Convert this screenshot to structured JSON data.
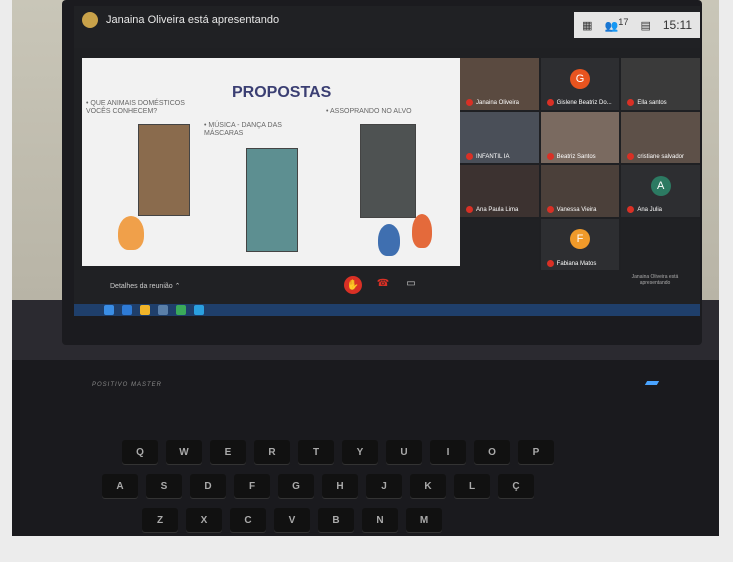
{
  "meeting": {
    "presenter_text": "Janaina Oliveira está apresentando",
    "clock": "15:11",
    "participant_count": "17",
    "details_label": "Detalhes da reunião",
    "present_label": "Janaina Oliveira está apresentando"
  },
  "slide": {
    "title": "PROPOSTAS",
    "item1": "• QUE ANIMAIS DOMÉSTICOS VOCÊS CONHECEM?",
    "item2": "• MÚSICA - DANÇA DAS MÁSCARAS",
    "item3": "• ASSOPRANDO NO ALVO"
  },
  "participants": [
    {
      "name": "Janaina Oliveira",
      "initial": "",
      "color": "#5a4a40"
    },
    {
      "name": "Gislene Beatriz Do...",
      "initial": "G",
      "color": "#e8541f"
    },
    {
      "name": "Ella santos",
      "initial": "",
      "color": "#3a3a3a"
    },
    {
      "name": "INFANTIL IA",
      "initial": "",
      "color": "#4a4f58"
    },
    {
      "name": "Beatriz Santos",
      "initial": "",
      "color": "#7a6a60"
    },
    {
      "name": "cristiane salvador",
      "initial": "",
      "color": "#5d5048"
    },
    {
      "name": "Ana Paula Lima",
      "initial": "",
      "color": "#3c3230"
    },
    {
      "name": "Vanessa Vieira",
      "initial": "",
      "color": "#4b403a"
    },
    {
      "name": "Ana Julia",
      "initial": "A",
      "color": "#2c7a62"
    },
    {
      "name": "",
      "initial": "",
      "color": "#202124"
    },
    {
      "name": "Fabiana Matos",
      "initial": "F",
      "color": "#f09a2a"
    },
    {
      "name": "",
      "initial": "",
      "color": "#202124"
    }
  ],
  "keyboard": {
    "brand": "POSITIVO MASTER",
    "row1": [
      "Q",
      "W",
      "E",
      "R",
      "T",
      "Y",
      "U",
      "I",
      "O",
      "P"
    ],
    "row2": [
      "A",
      "S",
      "D",
      "F",
      "G",
      "H",
      "J",
      "K",
      "L",
      "Ç"
    ],
    "row3": [
      "Z",
      "X",
      "C",
      "V",
      "B",
      "N",
      "M"
    ]
  }
}
